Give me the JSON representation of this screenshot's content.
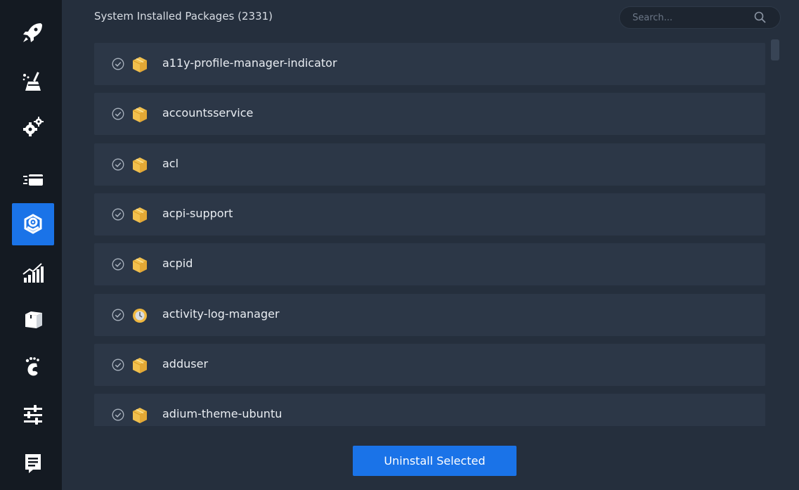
{
  "sidebar": {
    "items": [
      {
        "name": "rocket-icon"
      },
      {
        "name": "broom-cleaner-icon"
      },
      {
        "name": "gears-icon"
      },
      {
        "name": "startup-apps-icon"
      },
      {
        "name": "package-uninstaller-icon",
        "active": true
      },
      {
        "name": "resources-chart-icon"
      },
      {
        "name": "apt-box-icon"
      },
      {
        "name": "gnome-foot-icon"
      },
      {
        "name": "settings-sliders-icon"
      },
      {
        "name": "notes-icon"
      }
    ],
    "active_color": "#1a73e8"
  },
  "header": {
    "title": "System Installed Packages (2331)"
  },
  "search": {
    "placeholder": "Search..."
  },
  "packages": [
    {
      "name": "a11y-profile-manager-indicator",
      "icon": "package-box-icon"
    },
    {
      "name": "accountsservice",
      "icon": "package-box-icon"
    },
    {
      "name": "acl",
      "icon": "package-box-icon"
    },
    {
      "name": "acpi-support",
      "icon": "package-box-icon"
    },
    {
      "name": "acpid",
      "icon": "package-box-icon"
    },
    {
      "name": "activity-log-manager",
      "icon": "activity-log-icon"
    },
    {
      "name": "adduser",
      "icon": "package-box-icon"
    },
    {
      "name": "adium-theme-ubuntu",
      "icon": "package-box-icon"
    }
  ],
  "actions": {
    "uninstall_label": "Uninstall Selected"
  }
}
